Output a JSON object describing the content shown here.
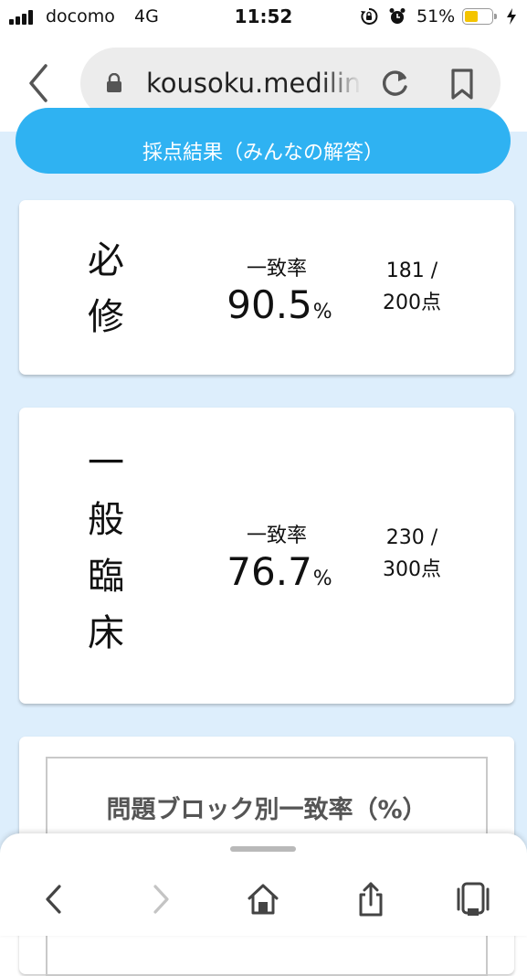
{
  "status_bar": {
    "carrier": "docomo",
    "network": "4G",
    "time": "11:52",
    "battery_percent": "51%",
    "battery_level": 0.51,
    "battery_color": "#f4c400"
  },
  "browser": {
    "url": "kousoku.medilink",
    "icons": [
      "back-icon",
      "lock-icon",
      "reload-icon",
      "bookmark-icon"
    ]
  },
  "results_button": {
    "label": "採点結果（みんなの解答）",
    "color": "#2fb2f2"
  },
  "cards": [
    {
      "subject_chars": [
        "必",
        "修"
      ],
      "rate_label": "一致率",
      "rate_value": "90.5",
      "rate_unit": "%",
      "score_line1": "181 /",
      "score_line2": "200点"
    },
    {
      "subject_chars": [
        "一",
        "般",
        "臨",
        "床"
      ],
      "rate_label": "一致率",
      "rate_value": "76.7",
      "rate_unit": "%",
      "score_line1": "230 /",
      "score_line2": "300点"
    }
  ],
  "block_section": {
    "title": "問題ブロック別一致率（%）"
  },
  "toolbar": {
    "icons": [
      "back-arrow-icon",
      "forward-arrow-icon",
      "home-icon",
      "share-icon",
      "tabs-icon"
    ]
  },
  "colors": {
    "page_background": "#ddeefc",
    "accent": "#2fb2f2"
  }
}
